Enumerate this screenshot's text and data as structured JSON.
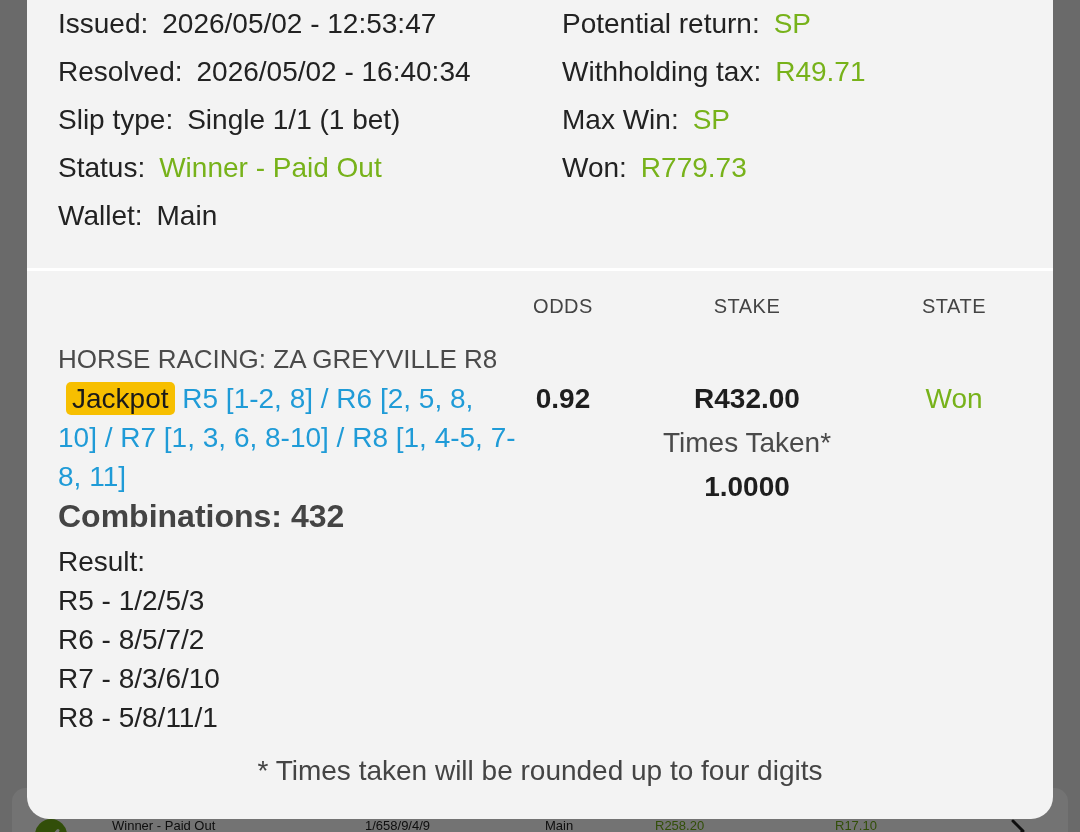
{
  "background_list": {
    "rows": [
      {
        "status": "Winner - Paid Out",
        "slip_id": "1/658/9/4/9",
        "wallet": "Main",
        "amount_1": "R258.20",
        "amount_2": "R17.10"
      }
    ]
  },
  "slip_details": {
    "left": [
      {
        "label": "Issued:",
        "value": "2026/05/02 - 12:53:47",
        "kind": "plain"
      },
      {
        "label": "Resolved:",
        "value": "2026/05/02 - 16:40:34",
        "kind": "plain"
      },
      {
        "label": "Slip type:",
        "value": "Single 1/1 (1 bet)",
        "kind": "plain"
      },
      {
        "label": "Status:",
        "value": "Winner - Paid Out",
        "kind": "positive"
      },
      {
        "label": "Wallet:",
        "value": "Main",
        "kind": "plain"
      }
    ],
    "right": [
      {
        "label": "Potential return:",
        "value": "SP",
        "kind": "positive"
      },
      {
        "label": "Withholding tax:",
        "value": "R49.71",
        "kind": "positive"
      },
      {
        "label": "Max Win:",
        "value": "SP",
        "kind": "positive"
      },
      {
        "label": "Won:",
        "value": "R779.73",
        "kind": "positive"
      }
    ]
  },
  "bet_table": {
    "columns": [
      "ODDS",
      "STAKE",
      "STATE"
    ],
    "rows": [
      {
        "event": "HORSE RACING: ZA GREYVILLE R8",
        "badge": "Jackpot",
        "selections": "R5 [1-2, 8] / R6 [2, 5, 8, 10] / R7 [1, 3, 6, 8-10] / R8 [1, 4-5, 7-8, 11]",
        "combinations": "Combinations: 432",
        "result_label": "Result:",
        "results": [
          "R5 - 1/2/5/3",
          "R6 - 8/5/7/2",
          "R7 - 8/3/6/10",
          "R8 - 5/8/11/1"
        ],
        "odds": "0.92",
        "stake": "R432.00",
        "times_taken_label": "Times Taken*",
        "times_taken": "1.0000",
        "state": "Won"
      }
    ]
  },
  "footnote": "* Times taken will be rounded up to four digits"
}
